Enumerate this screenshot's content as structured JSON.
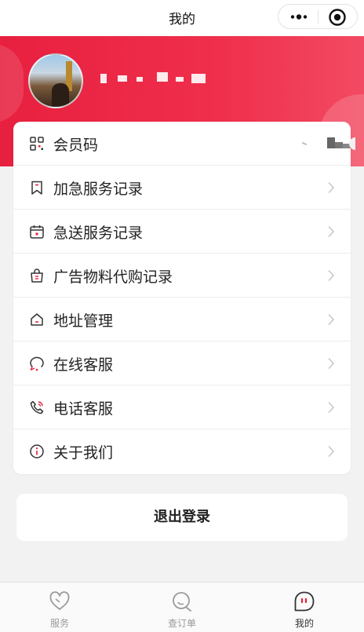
{
  "navbar": {
    "title": "我的"
  },
  "profile": {
    "username_masked": ""
  },
  "menu": {
    "items": [
      {
        "label": "会员码",
        "icon": "qr-grid-icon"
      },
      {
        "label": "加急服务记录",
        "icon": "bookmark-icon"
      },
      {
        "label": "急送服务记录",
        "icon": "calendar-icon"
      },
      {
        "label": "广告物料代购记录",
        "icon": "shopping-bag-icon"
      },
      {
        "label": "地址管理",
        "icon": "home-icon"
      },
      {
        "label": "在线客服",
        "icon": "chat-bubble-icon"
      },
      {
        "label": "电话客服",
        "icon": "phone-icon"
      },
      {
        "label": "关于我们",
        "icon": "info-icon"
      }
    ]
  },
  "logout": {
    "label": "退出登录"
  },
  "tabbar": {
    "items": [
      {
        "label": "服务",
        "icon": "heart-icon",
        "active": false
      },
      {
        "label": "查订单",
        "icon": "search-icon",
        "active": false
      },
      {
        "label": "我的",
        "icon": "profile-face-icon",
        "active": true
      }
    ]
  },
  "colors": {
    "brand_red": "#e8203f",
    "chevron": "#c8c8c8",
    "icon_dark": "#333333",
    "icon_red": "#e8203f"
  }
}
